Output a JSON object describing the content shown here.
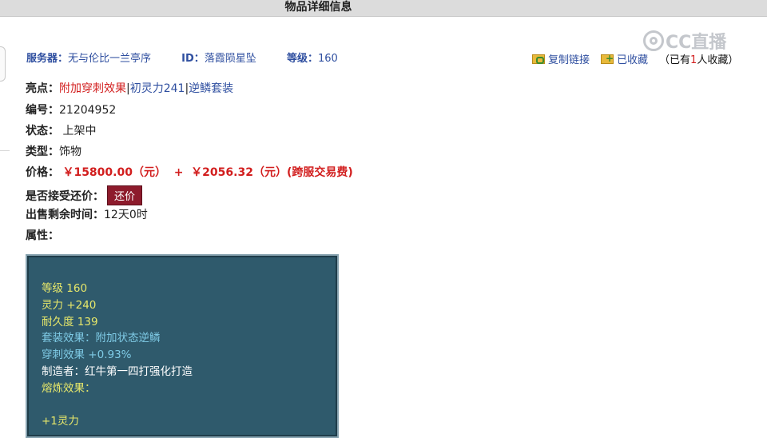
{
  "page": {
    "title": "物品详细信息"
  },
  "watermark": {
    "text": "CC直播"
  },
  "server": {
    "server_label": "服务器：",
    "server_value": "无与伦比一兰亭序",
    "id_label": "ID：",
    "id_value": "落霞陨星坠",
    "level_label": "等级：",
    "level_value": "160"
  },
  "tools": {
    "copy_link": "复制链接",
    "favorited": "已收藏",
    "fav_prefix": "（已有",
    "fav_num": "1",
    "fav_suffix": "人收藏）"
  },
  "details": {
    "highlight_label": "亮点：",
    "highlight_1": "附加穿刺效果",
    "sep_1": "|",
    "highlight_2": "初灵力241",
    "sep_2": "|",
    "highlight_3": "逆鳞套装",
    "number_label": "编号：",
    "number_value": "21204952",
    "status_label": "状态：",
    "status_value": "上架中",
    "type_label": "类型：",
    "type_value": "饰物",
    "price_label": "价格：",
    "price_value": "￥15800.00（元）  +  ￥2056.32（元）(跨服交易费)",
    "bargain_label": "是否接受还价：",
    "bargain_button": "还价",
    "time_label": "出售剩余时间：",
    "time_value": "12天0时",
    "attr_label": "属性："
  },
  "attributes": {
    "level": "等级 160",
    "spirit": "灵力 +240",
    "durability": "耐久度 139",
    "set_effect": "套装效果：附加状态逆鳞",
    "pierce": "穿刺效果 +0.93%",
    "maker": "制造者：红牛第一四打强化打造",
    "smelt": "熔炼效果：",
    "smelt_value": "+1灵力"
  }
}
